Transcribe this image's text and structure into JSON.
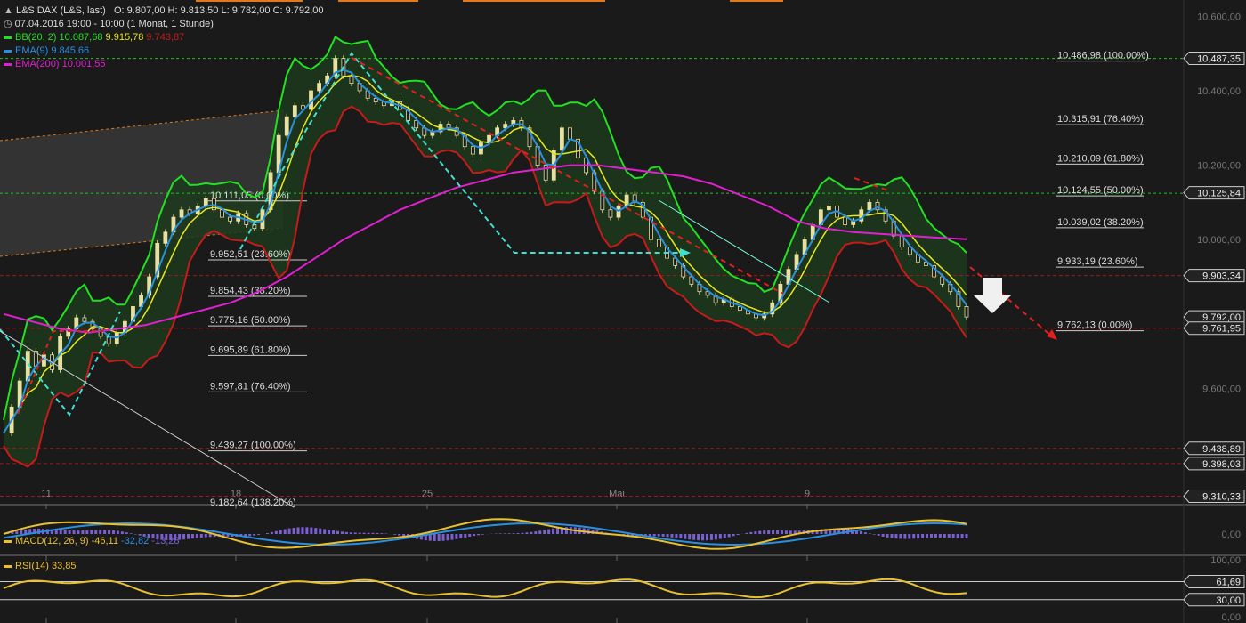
{
  "header": {
    "symbol": "L&S DAX (L&S, last)",
    "ohlc": "O: 9.807,00  H: 9.813,50  L: 9.782,00  C: 9.792,00",
    "period": "07.04.2016 19:00 - 10:00 (1 Monat, 1 Stunde)",
    "bb_label": "BB(20, 2)",
    "bb_upper": "10.087,68",
    "bb_mid": "9.915,78",
    "bb_lower": "9.743,87",
    "ema9_label": "EMA(9)",
    "ema9_value": "9.845,66",
    "ema200_label": "EMA(200)",
    "ema200_value": "10.001,55"
  },
  "colors": {
    "background": "#1a1a1a",
    "bb_band": "#22e022",
    "bb_fill": "#1c3a1c",
    "bb_lower": "#c81a1a",
    "bb_mid": "#e8e81a",
    "ema9": "#2a8fe0",
    "ema200": "#e020d0",
    "candle": "#e8e0a0",
    "fib_right": "#e0e0e0",
    "cyan_arrow": "#40e0d0",
    "red_arrow": "#e02020",
    "macd": "#e8c030",
    "macd_signal": "#2a8fe0",
    "macd_hist": "#7a60d0",
    "rsi": "#e8c030"
  },
  "chart_data": {
    "type": "line",
    "title": "L&S DAX (L&S, last)",
    "x_ticks": [
      "11",
      "18",
      "25",
      "Mai",
      "9"
    ],
    "y_ticks": [
      "10.600,00",
      "10.400,00",
      "10.200,00",
      "10.000,00",
      "9.600,00"
    ],
    "ylim": [
      9290,
      10620
    ],
    "price_tags": [
      {
        "value": 10487.35,
        "label": "10.487,35"
      },
      {
        "value": 10125.84,
        "label": "10.125,84"
      },
      {
        "value": 9903.34,
        "label": "9.903,34"
      },
      {
        "value": 9792.0,
        "label": "9.792,00",
        "highlight": true
      },
      {
        "value": 9761.95,
        "label": "9.761,95"
      },
      {
        "value": 9438.89,
        "label": "9.438,89"
      },
      {
        "value": 9398.03,
        "label": "9.398,03"
      },
      {
        "value": 9310.33,
        "label": "9.310,33"
      }
    ],
    "fib_right": [
      {
        "value": 10486.98,
        "label": "10.486,98 (100.00%)"
      },
      {
        "value": 10315.91,
        "label": "10.315,91 (76.40%)"
      },
      {
        "value": 10210.09,
        "label": "10.210,09 (61.80%)"
      },
      {
        "value": 10124.55,
        "label": "10.124,55 (50.00%)"
      },
      {
        "value": 10039.02,
        "label": "10.039,02 (38.20%)"
      },
      {
        "value": 9933.19,
        "label": "9.933,19 (23.60%)"
      },
      {
        "value": 9762.13,
        "label": "9.762,13 (0.00%)"
      }
    ],
    "fib_left": [
      {
        "value": 10111.05,
        "label": "10.111,05 (0.00%)"
      },
      {
        "value": 9952.51,
        "label": "9.952,51 (23.60%)"
      },
      {
        "value": 9854.43,
        "label": "9.854,43 (38.20%)"
      },
      {
        "value": 9775.16,
        "label": "9.775,16 (50.00%)"
      },
      {
        "value": 9695.89,
        "label": "9.695,89 (61.80%)"
      },
      {
        "value": 9597.81,
        "label": "9.597,81 (76.40%)"
      },
      {
        "value": 9439.27,
        "label": "9.439,27 (100.00%)"
      },
      {
        "value": 9182.64,
        "label": "9.182,64 (138.20%)"
      }
    ],
    "close_series": [
      9480,
      9550,
      9620,
      9700,
      9660,
      9690,
      9650,
      9740,
      9760,
      9790,
      9780,
      9760,
      9740,
      9720,
      9750,
      9780,
      9820,
      9850,
      9900,
      9990,
      10020,
      10060,
      10080,
      10070,
      10090,
      10110,
      10080,
      10060,
      10050,
      10070,
      10040,
      10030,
      10080,
      10180,
      10280,
      10330,
      10360,
      10350,
      10400,
      10420,
      10440,
      10487,
      10440,
      10420,
      10400,
      10380,
      10370,
      10360,
      10370,
      10350,
      10320,
      10300,
      10280,
      10290,
      10310,
      10300,
      10280,
      10250,
      10230,
      10260,
      10280,
      10300,
      10310,
      10320,
      10300,
      10250,
      10200,
      10160,
      10240,
      10300,
      10270,
      10220,
      10180,
      10130,
      10080,
      10060,
      10090,
      10120,
      10100,
      10060,
      10000,
      9980,
      9950,
      9930,
      9900,
      9880,
      9860,
      9850,
      9830,
      9840,
      9820,
      9810,
      9800,
      9790,
      9800,
      9830,
      9880,
      9920,
      9960,
      10000,
      10040,
      10080,
      10090,
      10060,
      10040,
      10050,
      10080,
      10100,
      10080,
      10050,
      10010,
      9980,
      9960,
      9940,
      9930,
      9900,
      9880,
      9860,
      9820,
      9792
    ],
    "ema200_series": [
      9800,
      9780,
      9760,
      9750,
      9760,
      9770,
      9790,
      9810,
      9830,
      9860,
      9900,
      9950,
      10000,
      10040,
      10080,
      10110,
      10140,
      10160,
      10180,
      10190,
      10200,
      10200,
      10190,
      10180,
      10170,
      10150,
      10120,
      10090,
      10050,
      10030,
      10020,
      10015,
      10010,
      10005,
      10001
    ],
    "macd": {
      "label": "MACD(12, 26, 9)",
      "values": [
        "-46,11",
        "-32,82",
        "-13,28"
      ],
      "zero_tick": "0,00"
    },
    "rsi": {
      "label": "RSI(14)",
      "value": "33,85",
      "ticks": [
        "100,00",
        "61,69",
        "30,00",
        "0,00"
      ],
      "levels": [
        61.69,
        30.0
      ]
    }
  }
}
